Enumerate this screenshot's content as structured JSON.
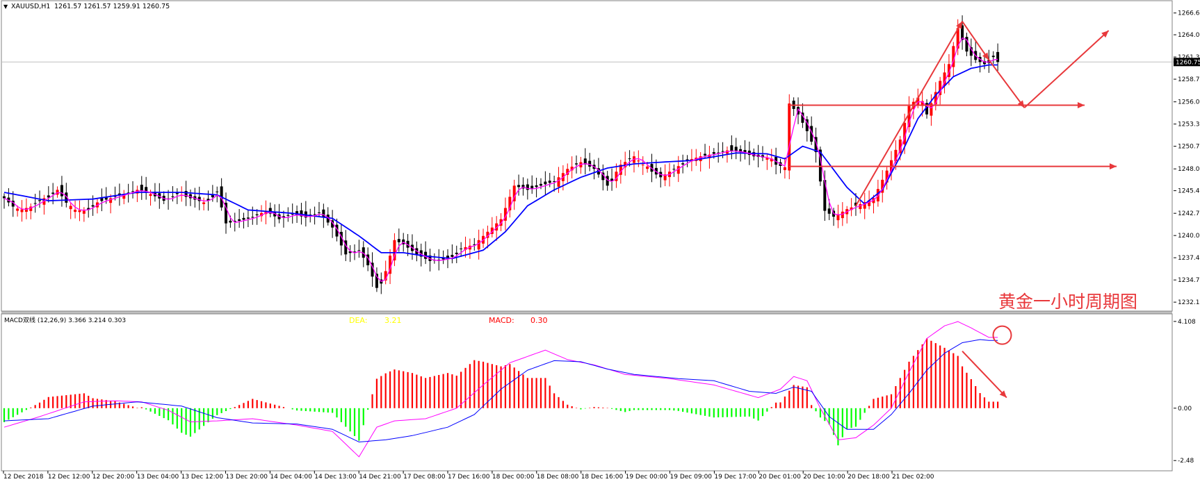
{
  "window": {
    "symbol_label": "XAUUSD,H1",
    "ohlc": "1261.57 1261.57 1259.91 1260.75",
    "collapse_icon": "triangle-down-icon"
  },
  "price_axis": {
    "range": [
      1231.2,
      1267.9
    ],
    "ticks": [
      "1266.60",
      "1264.00",
      "1261.35",
      "1258.70",
      "1256.00",
      "1253.35",
      "1250.70",
      "1248.00",
      "1245.40",
      "1242.70",
      "1240.05",
      "1237.40",
      "1234.75",
      "1232.10"
    ],
    "current_price": "1260.75",
    "current_value": 1260.75
  },
  "watermark": "黄金一小时周期图",
  "macd": {
    "title": "MACD双线 (12,26,9) 3.366 3.214 0.303",
    "dea_label": "DEA:",
    "dea_value": "3.21",
    "macd_label": "MACD:",
    "macd_value": "0.30",
    "range": [
      -2.9,
      4.4
    ],
    "ticks": [
      "4.108",
      "0.00",
      "-2.48"
    ],
    "tick_values": [
      4.108,
      0.0,
      -2.48
    ]
  },
  "time_axis": {
    "labels": [
      "12 Dec 2018",
      "12 Dec 12:00",
      "12 Dec 20:00",
      "13 Dec 04:00",
      "13 Dec 12:00",
      "13 Dec 20:00",
      "14 Dec 04:00",
      "14 Dec 13:00",
      "14 Dec 21:00",
      "17 Dec 08:00",
      "17 Dec 16:00",
      "18 Dec 00:00",
      "18 Dec 08:00",
      "18 Dec 16:00",
      "19 Dec 00:00",
      "19 Dec 09:00",
      "19 Dec 17:00",
      "20 Dec 01:00",
      "20 Dec 10:00",
      "20 Dec 18:00",
      "21 Dec 02:00"
    ]
  },
  "colors": {
    "bull": "#ff0000",
    "bear": "#000000",
    "ma_fast": "#ff00ff",
    "ma_slow": "#0000ff",
    "hist_pos": "#ff0000",
    "hist_neg": "#00ff00",
    "annotation": "#e8383b",
    "dea_text": "#ffff00",
    "macd_text": "#ff0000"
  },
  "chart_data": {
    "type": "candlestick",
    "symbol": "XAUUSD",
    "timeframe": "H1",
    "anchors": [
      [
        0,
        1244.5
      ],
      [
        3,
        1243
      ],
      [
        6,
        1243.5
      ],
      [
        9,
        1244.5
      ],
      [
        12,
        1245.5
      ],
      [
        15,
        1243.2
      ],
      [
        18,
        1243
      ],
      [
        21,
        1244
      ],
      [
        24,
        1244.5
      ],
      [
        27,
        1245
      ],
      [
        30,
        1245.5
      ],
      [
        33,
        1245
      ],
      [
        36,
        1244.2
      ],
      [
        39,
        1245
      ],
      [
        42,
        1244.5
      ],
      [
        45,
        1244
      ],
      [
        48,
        1245.3
      ],
      [
        50,
        1241.5
      ],
      [
        53,
        1241.8
      ],
      [
        56,
        1242.2
      ],
      [
        59,
        1243
      ],
      [
        62,
        1242
      ],
      [
        65,
        1242.6
      ],
      [
        68,
        1242.2
      ],
      [
        71,
        1242.8
      ],
      [
        74,
        1241
      ],
      [
        77,
        1237.8
      ],
      [
        80,
        1238.3
      ],
      [
        82,
        1236.5
      ],
      [
        84,
        1233.8
      ],
      [
        86,
        1235.8
      ],
      [
        88,
        1239.5
      ],
      [
        90,
        1239
      ],
      [
        93,
        1237.8
      ],
      [
        96,
        1237
      ],
      [
        99,
        1237.2
      ],
      [
        101,
        1237.5
      ],
      [
        103,
        1238.5
      ],
      [
        106,
        1239
      ],
      [
        109,
        1240.5
      ],
      [
        112,
        1242
      ],
      [
        115,
        1246
      ],
      [
        118,
        1245.5
      ],
      [
        121,
        1246
      ],
      [
        124,
        1246.5
      ],
      [
        127,
        1248
      ],
      [
        130,
        1248.8
      ],
      [
        133,
        1248
      ],
      [
        136,
        1246
      ],
      [
        139,
        1248.5
      ],
      [
        142,
        1249.5
      ],
      [
        145,
        1248
      ],
      [
        148,
        1247
      ],
      [
        151,
        1248
      ],
      [
        154,
        1249
      ],
      [
        157,
        1249.5
      ],
      [
        160,
        1249.8
      ],
      [
        163,
        1250.2
      ],
      [
        166,
        1250
      ],
      [
        169,
        1249.5
      ],
      [
        172,
        1249.3
      ],
      [
        174,
        1248.5
      ],
      [
        176,
        1248.2
      ],
      [
        177,
        1255.8
      ],
      [
        179,
        1254.5
      ],
      [
        181,
        1252.5
      ],
      [
        183,
        1250
      ],
      [
        185,
        1243
      ],
      [
        187,
        1242.3
      ],
      [
        190,
        1243.2
      ],
      [
        193,
        1243.8
      ],
      [
        196,
        1244.5
      ],
      [
        199,
        1247.8
      ],
      [
        202,
        1251.5
      ],
      [
        204,
        1255.5
      ],
      [
        206,
        1256.5
      ],
      [
        208,
        1254.5
      ],
      [
        211,
        1258.5
      ],
      [
        213,
        1260.5
      ],
      [
        215,
        1264.8
      ],
      [
        217,
        1262
      ],
      [
        219,
        1261
      ],
      [
        221,
        1260.5
      ],
      [
        223,
        1261.5
      ],
      [
        224,
        1260.75
      ]
    ],
    "bull_bar_indices": [
      3,
      4,
      5,
      6,
      9,
      12,
      15,
      16,
      17,
      18,
      21,
      24,
      27,
      30,
      33,
      40,
      45,
      58,
      59,
      86,
      87,
      88,
      104,
      105,
      107,
      108,
      109,
      110,
      111,
      112,
      113,
      114,
      115,
      125,
      126,
      127,
      128,
      130,
      138,
      139,
      140,
      142,
      143,
      144,
      145,
      149,
      150,
      152,
      155,
      156,
      157,
      159,
      163,
      172,
      173,
      176,
      177,
      188,
      189,
      190,
      191,
      193,
      194,
      195,
      196,
      197,
      198,
      199,
      200,
      201,
      202,
      203,
      204,
      205,
      206,
      207,
      209,
      210,
      211,
      212,
      213,
      214,
      215
    ],
    "ma_fast_offset": 0.8,
    "ma_slow_anchors": [
      [
        0,
        1245.2
      ],
      [
        10,
        1244.2
      ],
      [
        20,
        1244.4
      ],
      [
        30,
        1245.2
      ],
      [
        40,
        1245.2
      ],
      [
        48,
        1244.9
      ],
      [
        55,
        1243.1
      ],
      [
        65,
        1242.7
      ],
      [
        74,
        1242.1
      ],
      [
        80,
        1240
      ],
      [
        85,
        1238
      ],
      [
        90,
        1238
      ],
      [
        95,
        1237.6
      ],
      [
        101,
        1237.3
      ],
      [
        108,
        1238.3
      ],
      [
        113,
        1240.5
      ],
      [
        118,
        1243.6
      ],
      [
        124,
        1245.5
      ],
      [
        130,
        1247
      ],
      [
        136,
        1248.1
      ],
      [
        142,
        1248.6
      ],
      [
        148,
        1248.8
      ],
      [
        155,
        1249
      ],
      [
        165,
        1249.9
      ],
      [
        172,
        1249.8
      ],
      [
        176,
        1249.2
      ],
      [
        180,
        1250.7
      ],
      [
        184,
        1250
      ],
      [
        190,
        1245.8
      ],
      [
        194,
        1243.8
      ],
      [
        198,
        1245.5
      ],
      [
        202,
        1249.5
      ],
      [
        206,
        1254
      ],
      [
        210,
        1256.8
      ],
      [
        214,
        1259
      ],
      [
        218,
        1260
      ],
      [
        222,
        1260.4
      ]
    ],
    "macd_line_anchors": [
      [
        0,
        -0.9
      ],
      [
        8,
        -0.4
      ],
      [
        18,
        0.3
      ],
      [
        25,
        0.35
      ],
      [
        31,
        0.3
      ],
      [
        37,
        -0.1
      ],
      [
        42,
        -0.65
      ],
      [
        48,
        -0.6
      ],
      [
        56,
        -0.5
      ],
      [
        66,
        -0.8
      ],
      [
        74,
        -1.1
      ],
      [
        78,
        -1.9
      ],
      [
        80,
        -2.3
      ],
      [
        84,
        -0.9
      ],
      [
        88,
        -0.6
      ],
      [
        95,
        -0.5
      ],
      [
        102,
        0
      ],
      [
        108,
        1.1
      ],
      [
        114,
        2.15
      ],
      [
        118,
        2.45
      ],
      [
        122,
        2.75
      ],
      [
        127,
        2.3
      ],
      [
        133,
        2.05
      ],
      [
        140,
        1.6
      ],
      [
        150,
        1.4
      ],
      [
        160,
        1.1
      ],
      [
        170,
        0.5
      ],
      [
        175,
        0.9
      ],
      [
        178,
        1.5
      ],
      [
        181,
        1.3
      ],
      [
        184,
        0
      ],
      [
        188,
        -1.5
      ],
      [
        192,
        -1.4
      ],
      [
        196,
        -0.8
      ],
      [
        200,
        0
      ],
      [
        204,
        1.7
      ],
      [
        208,
        3.3
      ],
      [
        212,
        3.9
      ],
      [
        215,
        4.1
      ],
      [
        218,
        3.8
      ],
      [
        222,
        3.35
      ]
    ],
    "dea_line_anchors": [
      [
        0,
        -0.6
      ],
      [
        10,
        -0.5
      ],
      [
        20,
        0.1
      ],
      [
        30,
        0.3
      ],
      [
        40,
        0.1
      ],
      [
        48,
        -0.45
      ],
      [
        56,
        -0.7
      ],
      [
        66,
        -0.75
      ],
      [
        74,
        -1
      ],
      [
        80,
        -1.6
      ],
      [
        86,
        -1.5
      ],
      [
        92,
        -1.3
      ],
      [
        100,
        -0.9
      ],
      [
        106,
        -0.3
      ],
      [
        112,
        0.9
      ],
      [
        118,
        1.8
      ],
      [
        124,
        2.25
      ],
      [
        130,
        2.2
      ],
      [
        136,
        1.85
      ],
      [
        142,
        1.6
      ],
      [
        152,
        1.4
      ],
      [
        160,
        1.3
      ],
      [
        168,
        0.8
      ],
      [
        174,
        0.7
      ],
      [
        178,
        1
      ],
      [
        182,
        0.8
      ],
      [
        186,
        -0.4
      ],
      [
        190,
        -1
      ],
      [
        196,
        -1
      ],
      [
        200,
        -0.3
      ],
      [
        204,
        0.7
      ],
      [
        208,
        1.8
      ],
      [
        212,
        2.6
      ],
      [
        216,
        3.1
      ],
      [
        220,
        3.25
      ],
      [
        222,
        3.21
      ]
    ],
    "annotations": {
      "horizontal_levels": [
        1255.6,
        1248.3
      ],
      "path_up": [
        [
          192,
          1243.6
        ],
        [
          216,
          1265.6
        ]
      ],
      "path_top": [
        [
          216,
          1265.6
        ],
        [
          222,
          1261
        ]
      ],
      "path_projection": [
        [
          222,
          1261
        ],
        [
          230,
          1255.3
        ],
        [
          249,
          1264.5
        ]
      ],
      "macd_circle": {
        "index": 225,
        "value": 3.46
      },
      "macd_arrow": [
        [
          216,
          2.7
        ],
        [
          226,
          0.5
        ]
      ]
    }
  }
}
